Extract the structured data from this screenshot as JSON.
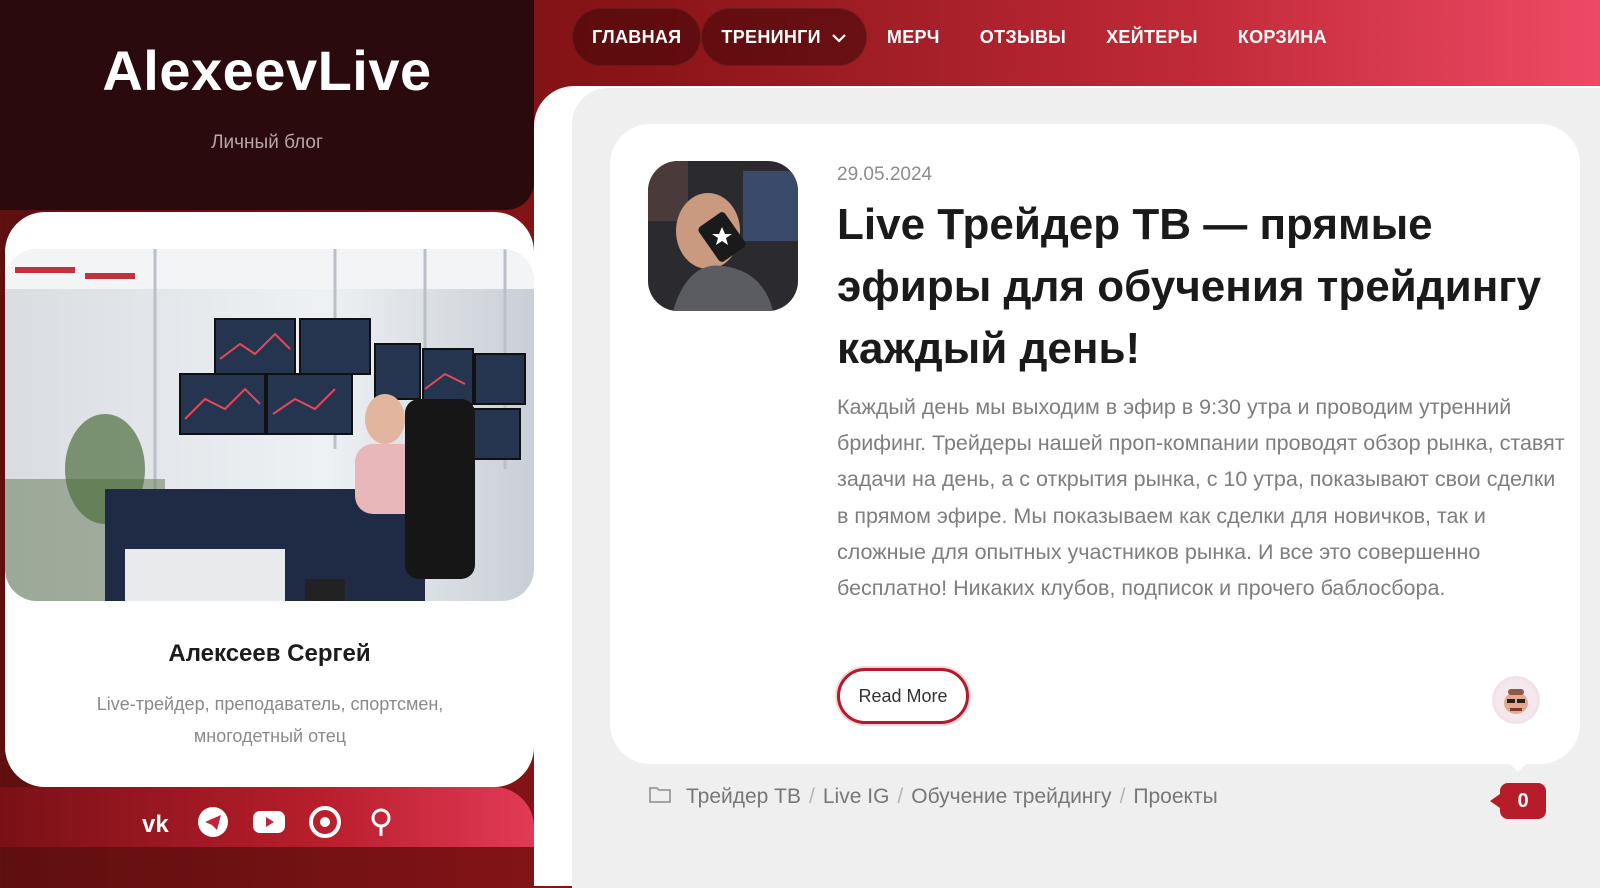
{
  "site": {
    "title": "AlexeevLive",
    "subtitle": "Личный блог"
  },
  "nav": {
    "items": [
      {
        "label": "ГЛАВНАЯ"
      },
      {
        "label": "ТРЕНИНГИ"
      },
      {
        "label": "МЕРЧ"
      },
      {
        "label": "ОТЗЫВЫ"
      },
      {
        "label": "ХЕЙТЕРЫ"
      },
      {
        "label": "КОРЗИНА"
      }
    ],
    "dropdown_icon": "chevron-down-icon"
  },
  "profile": {
    "name": "Алексеев Сергей",
    "bio": "Live-трейдер, преподаватель, спортсмен, многодетный отец"
  },
  "social": {
    "icons": [
      "vk-icon",
      "telegram-icon",
      "youtube-icon",
      "rutube-icon",
      "dzen-icon"
    ]
  },
  "post": {
    "date": "29.05.2024",
    "title": "Live Трейдер ТВ — прямые эфиры для обучения трейдингу каждый день!",
    "excerpt": "Каждый день мы выходим в эфир в 9:30 утра и проводим утренний брифинг. Трейдеры нашей проп-компании проводят обзор рынка, ставят задачи на день, а с открытия рынка, с 10 утра, показывают свои сделки в прямом эфире. Мы показываем как сделки для новичков, так и сложные для опытных участников рынка. И все это совершенно бесплатно! Никаких клубов, подписок и прочего баблосбора.",
    "read_more": "Read More",
    "categories": [
      "Трейдер ТВ",
      "Live IG",
      "Обучение трейдингу",
      "Проекты"
    ],
    "separator": "/",
    "comments": "0"
  },
  "colors": {
    "accent": "#b71c2b",
    "brand_bg": "#2a0a0c"
  }
}
